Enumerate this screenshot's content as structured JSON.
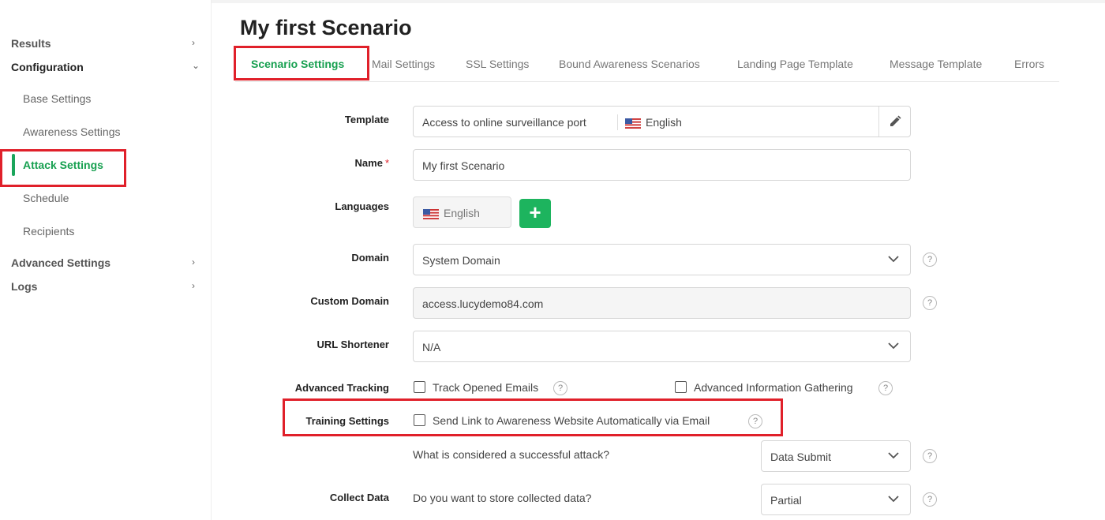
{
  "sidebar": {
    "results": "Results",
    "configuration": "Configuration",
    "sub": [
      "Base Settings",
      "Awareness Settings",
      "Attack Settings",
      "Schedule",
      "Recipients"
    ],
    "advanced": "Advanced Settings",
    "logs": "Logs"
  },
  "page": {
    "title": "My first Scenario"
  },
  "tabs": [
    "Scenario Settings",
    "Mail Settings",
    "SSL Settings",
    "Bound Awareness Scenarios",
    "Landing Page Template",
    "Message Template",
    "Errors"
  ],
  "form": {
    "template": {
      "label": "Template",
      "value": "Access to online surveillance port",
      "language": "English"
    },
    "name": {
      "label": "Name",
      "required": "*",
      "value": "My first Scenario"
    },
    "languages": {
      "label": "Languages",
      "value": "English",
      "add": "+"
    },
    "domain": {
      "label": "Domain",
      "value": "System Domain"
    },
    "custom_domain": {
      "label": "Custom Domain",
      "value": "access.lucydemo84.com"
    },
    "url_shortener": {
      "label": "URL Shortener",
      "value": "N/A"
    },
    "advanced_tracking": {
      "label": "Advanced Tracking",
      "opt1": "Track Opened Emails",
      "opt2": "Advanced Information Gathering"
    },
    "training": {
      "label": "Training Settings",
      "opt": "Send Link to Awareness Website Automatically via Email"
    },
    "success": {
      "question": "What is considered a successful attack?",
      "value": "Data Submit"
    },
    "collect": {
      "label": "Collect Data",
      "question": "Do you want to store collected data?",
      "value": "Partial"
    },
    "help": "?"
  },
  "colors": {
    "accent": "#17a050",
    "highlight": "#e0202a"
  }
}
